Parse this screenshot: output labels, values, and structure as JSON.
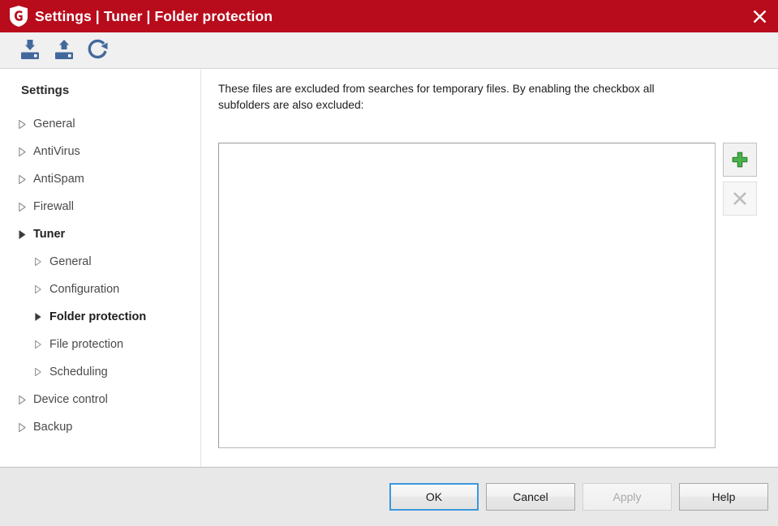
{
  "window": {
    "title": "Settings | Tuner | Folder protection",
    "logo_icon": "gdata-shield-logo",
    "close_icon": "close-icon",
    "titlebar_color": "#b80b1b"
  },
  "toolbar": {
    "items": [
      {
        "name": "import-settings-button",
        "icon": "download-to-disk-icon"
      },
      {
        "name": "export-settings-button",
        "icon": "upload-from-disk-icon"
      },
      {
        "name": "reset-settings-button",
        "icon": "reset-circular-arrow-icon"
      }
    ],
    "icon_color": "#43699c"
  },
  "sidebar": {
    "heading": "Settings",
    "items": [
      {
        "label": "General",
        "level": 1,
        "expanded": false,
        "selected": false
      },
      {
        "label": "AntiVirus",
        "level": 1,
        "expanded": false,
        "selected": false
      },
      {
        "label": "AntiSpam",
        "level": 1,
        "expanded": false,
        "selected": false
      },
      {
        "label": "Firewall",
        "level": 1,
        "expanded": false,
        "selected": false
      },
      {
        "label": "Tuner",
        "level": 1,
        "expanded": true,
        "selected": true
      },
      {
        "label": "General",
        "level": 2,
        "expanded": false,
        "selected": false
      },
      {
        "label": "Configuration",
        "level": 2,
        "expanded": false,
        "selected": false
      },
      {
        "label": "Folder protection",
        "level": 2,
        "expanded": true,
        "selected": true
      },
      {
        "label": "File protection",
        "level": 2,
        "expanded": false,
        "selected": false
      },
      {
        "label": "Scheduling",
        "level": 2,
        "expanded": false,
        "selected": false
      },
      {
        "label": "Device control",
        "level": 1,
        "expanded": false,
        "selected": false
      },
      {
        "label": "Backup",
        "level": 1,
        "expanded": false,
        "selected": false
      }
    ]
  },
  "main": {
    "description": "These files are excluded from searches for temporary files. By enabling the checkbox all subfolders are also excluded:",
    "list": {
      "items": []
    },
    "actions": [
      {
        "name": "add-entry-button",
        "icon": "green-plus-icon",
        "enabled": true,
        "color": "#3aa13a"
      },
      {
        "name": "remove-entry-button",
        "icon": "gray-x-icon",
        "enabled": false,
        "color": "#b4b4b4"
      }
    ]
  },
  "footer": {
    "buttons": [
      {
        "label": "OK",
        "name": "ok-button",
        "state": "default"
      },
      {
        "label": "Cancel",
        "name": "cancel-button",
        "state": "normal"
      },
      {
        "label": "Apply",
        "name": "apply-button",
        "state": "disabled"
      },
      {
        "label": "Help",
        "name": "help-button",
        "state": "normal"
      }
    ]
  }
}
